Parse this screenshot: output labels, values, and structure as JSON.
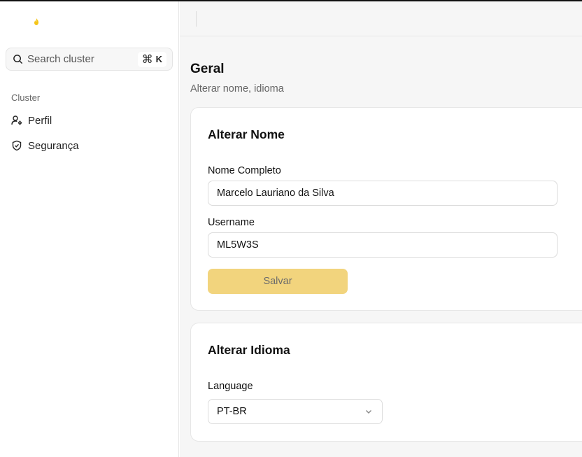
{
  "colors": {
    "accent": "#f2d47d",
    "logo": "#f5c518",
    "main_bg": "#f6f6f6"
  },
  "sidebar": {
    "logo_icon": "flame-icon",
    "search": {
      "placeholder": "Search cluster",
      "shortcut_symbol": "⌘",
      "shortcut_key": "K"
    },
    "group_label": "Cluster",
    "items": [
      {
        "label": "Perfil",
        "icon": "user-settings-icon"
      },
      {
        "label": "Segurança",
        "icon": "shield-icon"
      }
    ]
  },
  "page": {
    "title": "Geral",
    "subtitle": "Alterar nome, idioma"
  },
  "name_card": {
    "title": "Alterar Nome",
    "full_name_label": "Nome Completo",
    "full_name_value": "Marcelo Lauriano da Silva",
    "username_label": "Username",
    "username_value": "ML5W3S",
    "save_label": "Salvar"
  },
  "language_card": {
    "title": "Alterar Idioma",
    "language_label": "Language",
    "language_value": "PT-BR"
  }
}
